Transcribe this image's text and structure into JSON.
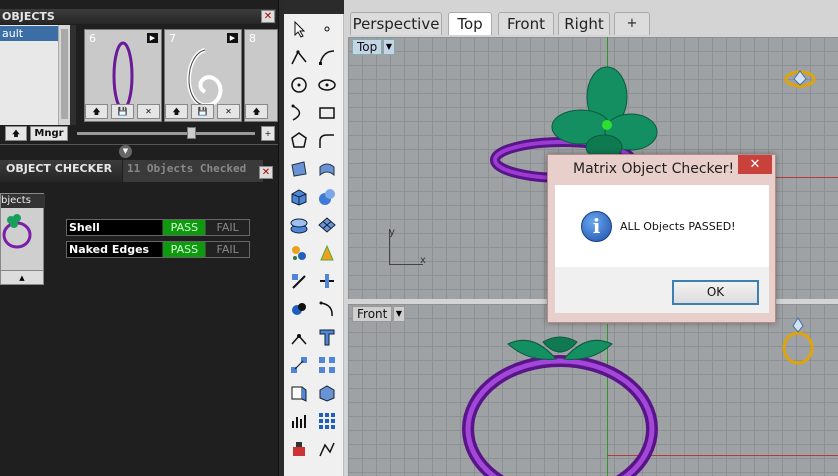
{
  "library_panel": {
    "title": "OBJECTS",
    "close_glyph": "✕",
    "list_item": "ault",
    "thumbnails": [
      {
        "number": "6",
        "play_glyph": "▶"
      },
      {
        "number": "7",
        "play_glyph": "▶"
      },
      {
        "number": "8"
      }
    ],
    "thumb_button_glyphs": [
      "🡅",
      "💾",
      "✕"
    ],
    "up_glyph": "🡅",
    "mngr_label": "Mngr",
    "plus_label": "+",
    "collapse_glyph": "▼"
  },
  "checker_panel": {
    "title": "OBJECT CHECKER",
    "status_tab": "11 Objects Checked",
    "close_glyph": "✕",
    "objects_label": "bjects",
    "expand_glyph": "▲",
    "rows": [
      {
        "label": "Shell",
        "pass": "PASS",
        "fail": "FAIL"
      },
      {
        "label": "Naked Edges",
        "pass": "PASS",
        "fail": "FAIL"
      }
    ]
  },
  "tabs": [
    {
      "label": "Perspective"
    },
    {
      "label": "Top"
    },
    {
      "label": "Front"
    },
    {
      "label": "Right"
    },
    {
      "label": "+"
    }
  ],
  "viewports": {
    "top": {
      "label": "Top",
      "dropdown": "▼",
      "axis_x": "x",
      "axis_y": "y"
    },
    "front": {
      "label": "Front",
      "dropdown": "▼"
    }
  },
  "dialog": {
    "title": "Matrix Object Checker!",
    "message": "ALL Objects PASSED!",
    "info_glyph": "i",
    "ok_label": "OK",
    "close_glyph": "✕"
  },
  "colors": {
    "pass_green": "#0e9a0e",
    "ring_purple": "#7a1fa6",
    "leaf_green": "#0f8a5a",
    "gold": "#e0a40b",
    "dialog_border": "#e9cfcb",
    "close_red": "#c8413a",
    "ok_border": "#3c7fb1"
  }
}
